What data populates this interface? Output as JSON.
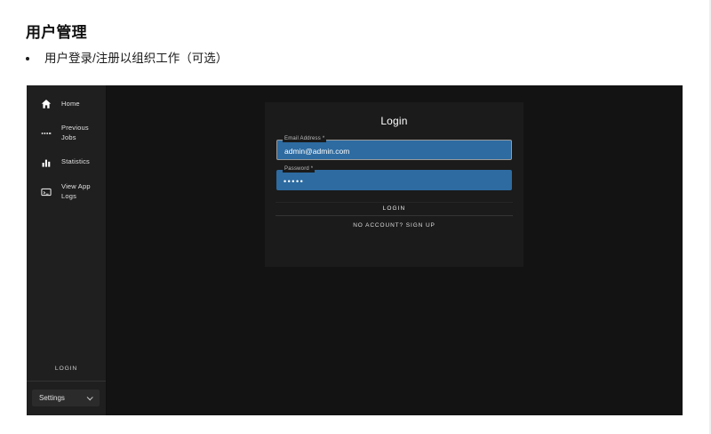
{
  "page": {
    "title": "用户管理",
    "bullet": "用户登录/注册以组织工作（可选）"
  },
  "app": {
    "sidebar": {
      "items": [
        {
          "label": "Home",
          "icon": "home-icon"
        },
        {
          "label": "Previous Jobs",
          "icon": "previous-jobs-icon"
        },
        {
          "label": "Statistics",
          "icon": "statistics-icon"
        },
        {
          "label": "View App Logs",
          "icon": "app-logs-icon"
        }
      ],
      "login_label": "LOGIN",
      "settings": {
        "label": "Settings",
        "icon": "chevron-down-icon"
      }
    },
    "login_card": {
      "title": "Login",
      "email_label": "Email Address *",
      "email_value": "admin@admin.com",
      "password_label": "Password *",
      "password_value": "•••••",
      "login_button": "LOGIN",
      "signup_link": "NO ACCOUNT? SIGN UP"
    },
    "colors": {
      "input_bg": "#2d6ba1",
      "sidebar_bg": "#1e1f1e",
      "main_bg": "#131313",
      "card_bg": "#1b1b1b"
    }
  }
}
